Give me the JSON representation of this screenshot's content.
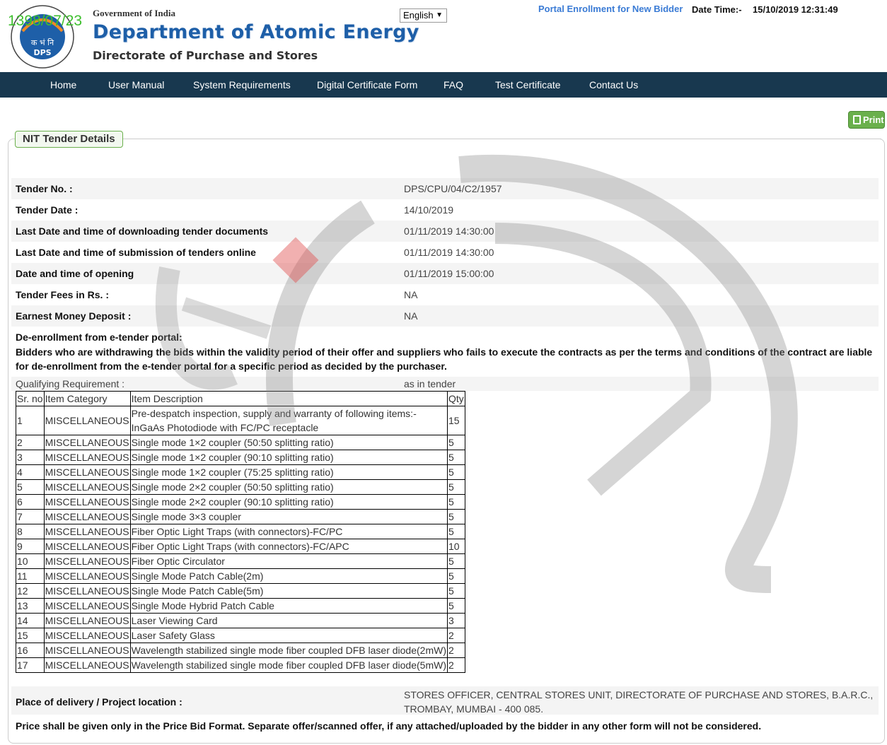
{
  "header": {
    "logo_text": "DPS",
    "logo_hindi": "क भं नि",
    "logo_ring_top": "राष्ट्र की सेवा में परमाणु",
    "logo_ring_bottom": "ATOMS IN THE SERVICE OF THE NATION",
    "gov_line": "Government of India",
    "dept_line": "Department of Atomic Energy",
    "dir_line": "Directorate of Purchase and Stores",
    "watermark_date": "1398/07/23",
    "language": "English",
    "portal_link": "Portal Enrollment for New Bidder",
    "datetime_label": "Date Time:-",
    "datetime_value": "15/10/2019 12:31:49"
  },
  "nav": [
    "Home",
    "User Manual",
    "System Requirements",
    "Digital Certificate Form",
    "FAQ",
    "Test Certificate",
    "Contact Us"
  ],
  "print_label": "Print",
  "section_title": "NIT Tender Details",
  "details": [
    {
      "label": "Tender No. :",
      "value": "DPS/CPU/04/C2/1957"
    },
    {
      "label": "Tender Date :",
      "value": "14/10/2019"
    },
    {
      "label": "Last Date and time of downloading tender documents",
      "value": "01/11/2019 14:30:00"
    },
    {
      "label": "Last Date and time of submission of tenders online",
      "value": "01/11/2019 14:30:00"
    },
    {
      "label": "Date and time of opening",
      "value": "01/11/2019 15:00:00"
    },
    {
      "label": "Tender Fees in Rs. :",
      "value": "NA"
    },
    {
      "label": "Earnest Money Deposit :",
      "value": "NA"
    }
  ],
  "deenrollment": {
    "title": "De-enrollment from e-tender portal:",
    "text": "Bidders who are withdrawing the bids within the validity period of their offer and suppliers who fails to execute the contracts as per the terms and conditions of the contract are liable for de-enrollment from the e-tender portal for a specific period as decided by the purchaser."
  },
  "qualifying": {
    "label": "Qualifying Requirement :",
    "value": "as in tender"
  },
  "items_table": {
    "headers": [
      "Sr. no",
      "Item Category",
      "Item Description",
      "Qty"
    ],
    "rows": [
      [
        "1",
        "MISCELLANEOUS",
        "Pre-despatch inspection, supply and warranty of following items:- InGaAs Photodiode with FC/PC receptacle",
        "15"
      ],
      [
        "2",
        "MISCELLANEOUS",
        "Single mode 1×2 coupler (50:50 splitting ratio)",
        "5"
      ],
      [
        "3",
        "MISCELLANEOUS",
        "Single mode 1×2 coupler (90:10 splitting ratio)",
        "5"
      ],
      [
        "4",
        "MISCELLANEOUS",
        "Single mode 1×2 coupler (75:25 splitting ratio)",
        "5"
      ],
      [
        "5",
        "MISCELLANEOUS",
        "Single mode 2×2 coupler (50:50 splitting ratio)",
        "5"
      ],
      [
        "6",
        "MISCELLANEOUS",
        "Single mode 2×2 coupler (90:10 splitting ratio)",
        "5"
      ],
      [
        "7",
        "MISCELLANEOUS",
        "Single mode 3×3 coupler",
        "5"
      ],
      [
        "8",
        "MISCELLANEOUS",
        "Fiber Optic Light Traps (with connectors)-FC/PC",
        "5"
      ],
      [
        "9",
        "MISCELLANEOUS",
        "Fiber Optic Light Traps (with connectors)-FC/APC",
        "10"
      ],
      [
        "10",
        "MISCELLANEOUS",
        "Fiber Optic Circulator",
        "5"
      ],
      [
        "11",
        "MISCELLANEOUS",
        "Single Mode Patch Cable(2m)",
        "5"
      ],
      [
        "12",
        "MISCELLANEOUS",
        "Single Mode Patch Cable(5m)",
        "5"
      ],
      [
        "13",
        "MISCELLANEOUS",
        "Single Mode Hybrid Patch Cable",
        "5"
      ],
      [
        "14",
        "MISCELLANEOUS",
        "Laser Viewing Card",
        "3"
      ],
      [
        "15",
        "MISCELLANEOUS",
        "Laser Safety Glass",
        "2"
      ],
      [
        "16",
        "MISCELLANEOUS",
        "Wavelength stabilized single mode fiber coupled DFB laser diode(2mW)",
        "2"
      ],
      [
        "17",
        "MISCELLANEOUS",
        "Wavelength stabilized single mode fiber coupled DFB laser diode(5mW)",
        "2"
      ]
    ]
  },
  "place": {
    "label": "Place of delivery / Project location :",
    "value": "STORES OFFICER, CENTRAL STORES UNIT, DIRECTORATE OF PURCHASE AND STORES, B.A.R.C., TROMBAY, MUMBAI - 400 085."
  },
  "price_note": "Price shall be given only in the Price Bid Format. Separate offer/scanned offer, if any attached/uploaded by the bidder in any other form will not be considered.",
  "colors": {
    "nav_bg": "#18384f",
    "dept_blue": "#1e5fa8",
    "link_blue": "#3a7bd5",
    "print_green": "#6ab04c",
    "watermark_green": "#3fbf2f"
  }
}
